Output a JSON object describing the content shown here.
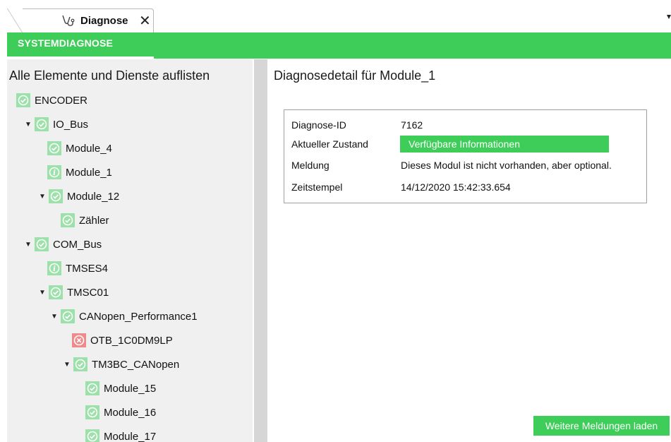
{
  "tab": {
    "label": "Diagnose",
    "close": "✕"
  },
  "subtab": {
    "label": "SYSTEMDIAGNOSE"
  },
  "left": {
    "title": "Alle Elemente und Dienste auflisten"
  },
  "tree": [
    {
      "label": "ENCODER",
      "status": "ok",
      "expanded": null
    },
    {
      "label": "IO_Bus",
      "status": "ok",
      "expanded": true
    },
    {
      "label": "Module_4",
      "status": "ok",
      "expanded": null
    },
    {
      "label": "Module_1",
      "status": "info",
      "expanded": null
    },
    {
      "label": "Module_12",
      "status": "ok",
      "expanded": true
    },
    {
      "label": "Zähler",
      "status": "ok",
      "expanded": null
    },
    {
      "label": "COM_Bus",
      "status": "ok",
      "expanded": true
    },
    {
      "label": "TMSES4",
      "status": "info",
      "expanded": null
    },
    {
      "label": "TMSC01",
      "status": "ok",
      "expanded": true
    },
    {
      "label": "CANopen_Performance1",
      "status": "ok",
      "expanded": true
    },
    {
      "label": "OTB_1C0DM9LP",
      "status": "error",
      "expanded": null
    },
    {
      "label": "TM3BC_CANopen",
      "status": "ok",
      "expanded": true
    },
    {
      "label": "Module_15",
      "status": "ok",
      "expanded": null
    },
    {
      "label": "Module_16",
      "status": "ok",
      "expanded": null
    },
    {
      "label": "Module_17",
      "status": "ok",
      "expanded": null
    }
  ],
  "detail": {
    "title": "Diagnosedetail für Module_1",
    "rows": [
      {
        "key": "Diagnose-ID",
        "value": "7162"
      },
      {
        "key": "Aktueller Zustand",
        "value": "Verfügbare Informationen"
      },
      {
        "key": "Meldung",
        "value": "Dieses Modul ist nicht vorhanden, aber optional."
      },
      {
        "key": "Zeitstempel",
        "value": "14/12/2020 15:42:33.654"
      }
    ]
  },
  "actions": {
    "load_more": "Weitere Meldungen laden"
  },
  "colors": {
    "accent": "#3dcd58",
    "ok_bg": "#9be1a9",
    "error_bg": "#f0898b"
  }
}
